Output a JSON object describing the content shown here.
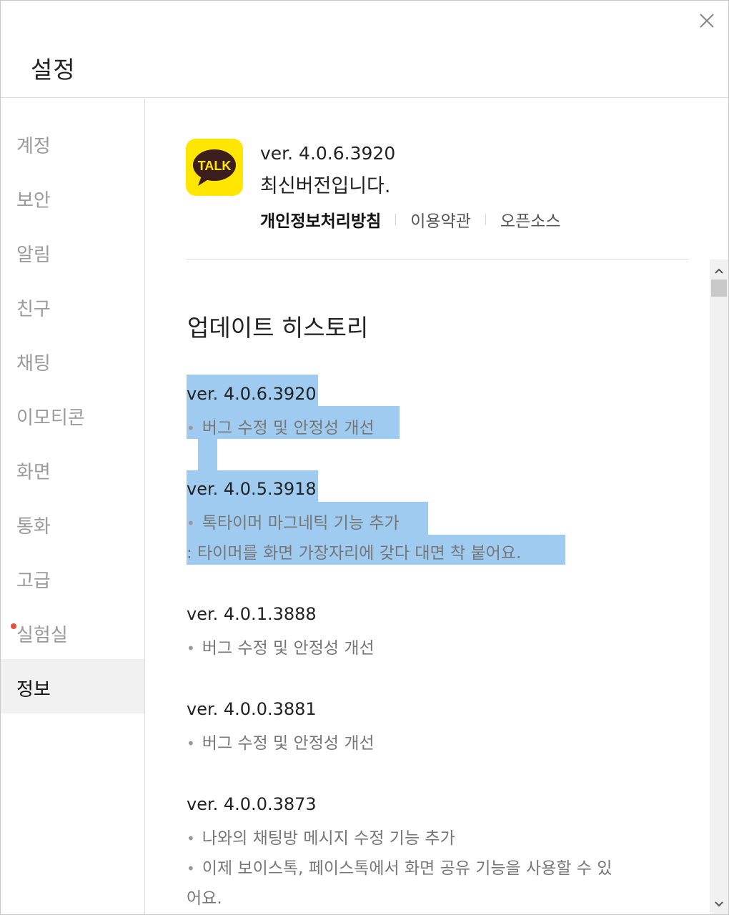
{
  "window": {
    "title": "설정",
    "close_icon": "close-icon"
  },
  "sidebar": {
    "items": [
      {
        "label": "계정"
      },
      {
        "label": "보안"
      },
      {
        "label": "알림"
      },
      {
        "label": "친구"
      },
      {
        "label": "채팅"
      },
      {
        "label": "이모티콘"
      },
      {
        "label": "화면"
      },
      {
        "label": "통화"
      },
      {
        "label": "고급"
      },
      {
        "label": "실험실",
        "has_dot": true
      },
      {
        "label": "정보",
        "active": true
      }
    ]
  },
  "about": {
    "logo_text": "TALK",
    "version": "ver. 4.0.6.3920",
    "status": "최신버전입니다.",
    "links": {
      "privacy": "개인정보처리방침",
      "terms": "이용약관",
      "oss": "오픈소스"
    }
  },
  "history": {
    "title": "업데이트 히스토리",
    "entries": [
      {
        "version": "ver. 4.0.6.3920",
        "notes": [
          "버그 수정 및 안정성 개선"
        ]
      },
      {
        "version": "ver. 4.0.5.3918",
        "notes": [
          "톡타이머 마그네틱 기능 추가",
          ": 타이머를 화면 가장자리에 갖다 대면 착 붙어요."
        ]
      },
      {
        "version": "ver. 4.0.1.3888",
        "notes": [
          "버그 수정 및 안정성 개선"
        ]
      },
      {
        "version": "ver. 4.0.0.3881",
        "notes": [
          "버그 수정 및 안정성 개선"
        ]
      },
      {
        "version": "ver. 4.0.0.3873",
        "notes": [
          "나와의 채팅방 메시지 수정 기능 추가",
          "이제 보이스톡, 페이스톡에서 화면 공유 기능을 사용할 수 있",
          "어요."
        ]
      }
    ],
    "bullet": "•"
  },
  "colors": {
    "selection": "#9ecbef",
    "logo_yellow": "#ffe600",
    "logo_brown": "#3c1e1e",
    "badge_red": "#e8503a"
  }
}
